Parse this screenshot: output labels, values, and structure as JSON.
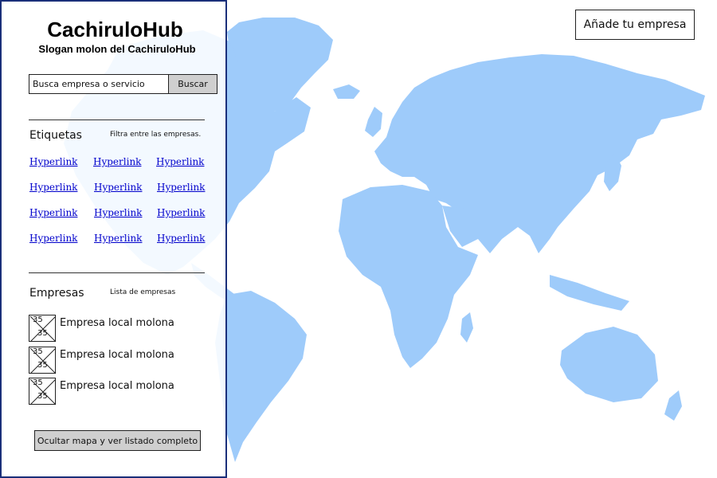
{
  "header": {
    "add_company_label": "Añade tu empresa"
  },
  "brand": {
    "title": "CachiruloHub",
    "slogan": "Slogan molon del CachiruloHub"
  },
  "search": {
    "placeholder": "Busca empresa o servicio",
    "button_label": "Buscar"
  },
  "tags": {
    "title": "Etiquetas",
    "subtitle": "Filtra entre las empresas.",
    "links": [
      [
        "Hyperlink",
        "Hyperlink",
        "Hyperlink"
      ],
      [
        "Hyperlink",
        "Hyperlink",
        "Hyperlink"
      ],
      [
        "Hyperlink",
        "Hyperlink",
        "Hyperlink"
      ],
      [
        "Hyperlink",
        "Hyperlink",
        "Hyperlink"
      ]
    ]
  },
  "companies": {
    "title": "Empresas",
    "subtitle": "Lista de empresas",
    "items": [
      {
        "logo_top": "35",
        "logo_bottom": "35",
        "name": "Empresa local molona"
      },
      {
        "logo_top": "35",
        "logo_bottom": "35",
        "name": "Empresa local molona"
      },
      {
        "logo_top": "35",
        "logo_bottom": "35",
        "name": "Empresa local molona"
      }
    ]
  },
  "footer": {
    "hide_map_label": "Ocultar mapa y ver listado completo"
  },
  "colors": {
    "map_land": "#9ecbfa",
    "panel_border": "#1a2f7a",
    "link": "#0000cc",
    "button_gray": "#cfcfcf"
  }
}
